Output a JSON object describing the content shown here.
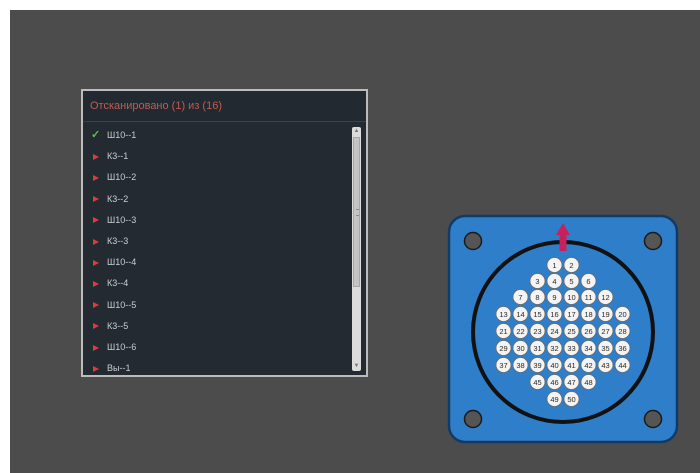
{
  "panel": {
    "header": "Отсканировано (1) из (16)",
    "items": [
      {
        "label": "Ш10--1",
        "status": "done"
      },
      {
        "label": "К3--1",
        "status": "pending"
      },
      {
        "label": "Ш10--2",
        "status": "pending"
      },
      {
        "label": "К3--2",
        "status": "pending"
      },
      {
        "label": "Ш10--3",
        "status": "pending"
      },
      {
        "label": "К3--3",
        "status": "pending"
      },
      {
        "label": "Ш10--4",
        "status": "pending"
      },
      {
        "label": "К3--4",
        "status": "pending"
      },
      {
        "label": "Ш10--5",
        "status": "pending"
      },
      {
        "label": "К3--5",
        "status": "pending"
      },
      {
        "label": "Ш10--6",
        "status": "pending"
      },
      {
        "label": "Вы--1",
        "status": "pending"
      }
    ]
  },
  "connector": {
    "pin_rows": [
      [
        "1",
        "2"
      ],
      [
        "3",
        "4",
        "5",
        "6"
      ],
      [
        "7",
        "8",
        "9",
        "10",
        "11",
        "12"
      ],
      [
        "13",
        "14",
        "15",
        "16",
        "17",
        "18",
        "19",
        "20"
      ],
      [
        "21",
        "22",
        "23",
        "24",
        "25",
        "26",
        "27",
        "28"
      ],
      [
        "29",
        "30",
        "31",
        "32",
        "33",
        "34",
        "35",
        "36"
      ],
      [
        "37",
        "38",
        "39",
        "40",
        "41",
        "42",
        "43",
        "44"
      ],
      [
        "45",
        "46",
        "47",
        "48"
      ],
      [
        "49",
        "50"
      ]
    ],
    "colors": {
      "body": "#2f7ec9",
      "pin": "#f4f4f4",
      "ring": "#111111",
      "key": "#c8205a"
    }
  }
}
